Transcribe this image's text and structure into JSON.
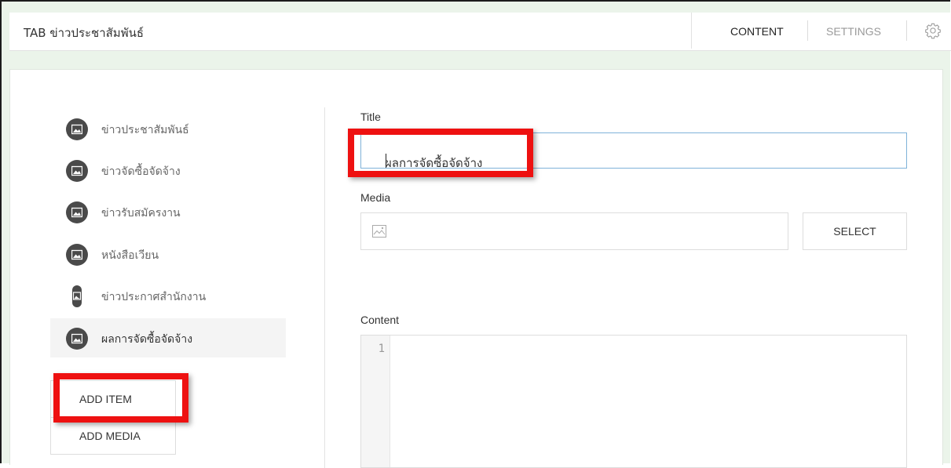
{
  "header": {
    "title": "TAB ข่าวประชาสัมพันธ์",
    "tabs": [
      {
        "label": "CONTENT",
        "active": true
      },
      {
        "label": "SETTINGS",
        "active": false
      }
    ],
    "settings_icon": "gear-icon"
  },
  "sidebar": {
    "items": [
      {
        "label": "ข่าวประชาสัมพันธ์",
        "icon": "image-icon",
        "active": false
      },
      {
        "label": "ข่าวจัดซื้อจัดจ้าง",
        "icon": "image-icon",
        "active": false
      },
      {
        "label": "ข่าวรับสมัครงาน",
        "icon": "image-icon",
        "active": false
      },
      {
        "label": "หนังสือเวียน",
        "icon": "image-icon",
        "active": false
      },
      {
        "label": "ข่าวประกาศสำนักงาน",
        "icon": "image-icon",
        "active": false
      },
      {
        "label": "ผลการจัดซื้อจัดจ้าง",
        "icon": "image-icon",
        "active": true
      }
    ],
    "add_item_label": "ADD ITEM",
    "add_media_label": "ADD MEDIA"
  },
  "form": {
    "title_label": "Title",
    "title_value": "ผลการจัดซื้อจัดจ้าง",
    "media_label": "Media",
    "media_value": "",
    "select_label": "SELECT",
    "content_label": "Content",
    "editor_line_numbers": [
      "1"
    ],
    "content_value": ""
  },
  "colors": {
    "background": "#ebf4ea",
    "highlight": "#ee1111",
    "focus_border": "#7fb2d9",
    "icon_circle": "#4a4a4a"
  }
}
